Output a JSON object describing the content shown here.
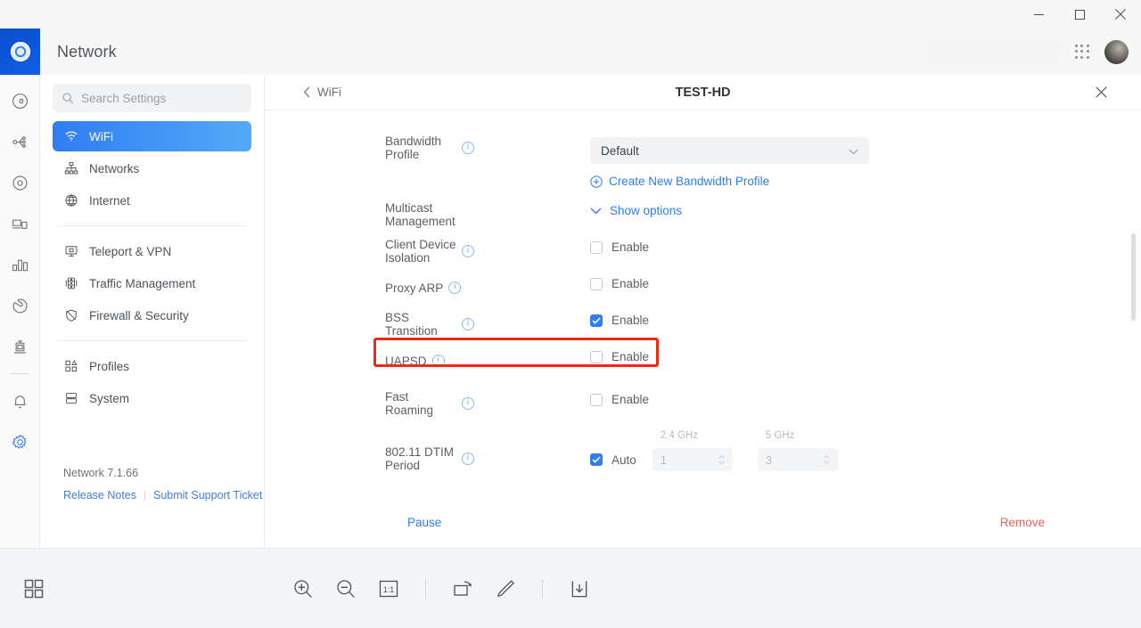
{
  "window": {
    "controls": [
      {
        "name": "minimize",
        "glyph": "minimize-icon"
      },
      {
        "name": "maximize",
        "glyph": "maximize-icon"
      },
      {
        "name": "close",
        "glyph": "close-icon"
      }
    ]
  },
  "rail": {
    "logo_name": "unifi-logo-icon",
    "items": [
      {
        "name": "rail-icon-dashboard",
        "active": false
      },
      {
        "name": "rail-icon-topology",
        "active": false
      },
      {
        "name": "rail-icon-devices",
        "active": false
      },
      {
        "name": "rail-icon-clients",
        "active": false
      },
      {
        "name": "rail-icon-insights",
        "active": false
      },
      {
        "name": "rail-icon-protect",
        "active": false
      },
      {
        "name": "rail-icon-hotspot",
        "active": false
      },
      {
        "name": "rail-icon-alerts",
        "active": false
      },
      {
        "name": "rail-icon-settings",
        "active": true
      }
    ]
  },
  "header": {
    "title": "Network",
    "search_ghost": "",
    "apps_icon": "grid-apps-icon",
    "avatar": "user-avatar"
  },
  "sidebar": {
    "search": {
      "placeholder": "Search Settings",
      "value": ""
    },
    "groups": [
      {
        "items": [
          {
            "label": "WiFi",
            "icon": "wifi-icon",
            "active": true
          },
          {
            "label": "Networks",
            "icon": "networks-icon",
            "active": false
          },
          {
            "label": "Internet",
            "icon": "globe-icon",
            "active": false
          }
        ]
      },
      {
        "items": [
          {
            "label": "Teleport & VPN",
            "icon": "teleport-vpn-icon",
            "active": false
          },
          {
            "label": "Traffic Management",
            "icon": "traffic-management-icon",
            "active": false
          },
          {
            "label": "Firewall & Security",
            "icon": "shield-icon",
            "active": false
          }
        ]
      },
      {
        "items": [
          {
            "label": "Profiles",
            "icon": "profiles-icon",
            "active": false
          },
          {
            "label": "System",
            "icon": "system-icon",
            "active": false
          }
        ]
      }
    ],
    "version": "Network 7.1.66",
    "release_notes": "Release Notes",
    "support_ticket": "Submit Support Ticket"
  },
  "detail": {
    "back_label": "WiFi",
    "title": "TEST-HD",
    "close_icon": "close-icon",
    "rows": {
      "bandwidth_profile": {
        "label": "Bandwidth Profile",
        "selected": "Default",
        "create_link": "Create New Bandwidth Profile"
      },
      "multicast": {
        "label": "Multicast Management",
        "link": "Show options"
      },
      "client_isolation": {
        "label": "Client Device Isolation",
        "checkbox_label": "Enable",
        "checked": false
      },
      "proxy_arp": {
        "label": "Proxy ARP",
        "checkbox_label": "Enable",
        "checked": false
      },
      "bss_transition": {
        "label": "BSS Transition",
        "checkbox_label": "Enable",
        "checked": true
      },
      "uapsd": {
        "label": "UAPSD",
        "checkbox_label": "Enable",
        "checked": false
      },
      "fast_roaming": {
        "label": "Fast Roaming",
        "checkbox_label": "Enable",
        "checked": false,
        "highlighted": true
      },
      "dtim": {
        "label": "802.11 DTIM Period",
        "auto_label": "Auto",
        "auto_checked": true,
        "band_24_caption": "2.4 GHz",
        "band_24_value": "1",
        "band_5_caption": "5 GHz",
        "band_5_value": "3"
      }
    },
    "pause_label": "Pause",
    "remove_label": "Remove"
  },
  "bottombar": {
    "grid_icon": "grid-view-icon",
    "tools": [
      {
        "name": "zoom-in-icon"
      },
      {
        "name": "zoom-out-icon"
      },
      {
        "name": "actual-size-icon",
        "text": "1:1"
      },
      {
        "name": "rotate-icon"
      },
      {
        "name": "annotate-pencil-icon"
      },
      {
        "name": "save-download-icon"
      }
    ]
  },
  "colors": {
    "accent": "#2f7df2",
    "highlight": "#ee2b12",
    "danger": "#e8635f",
    "logo": "#0b55d8"
  }
}
